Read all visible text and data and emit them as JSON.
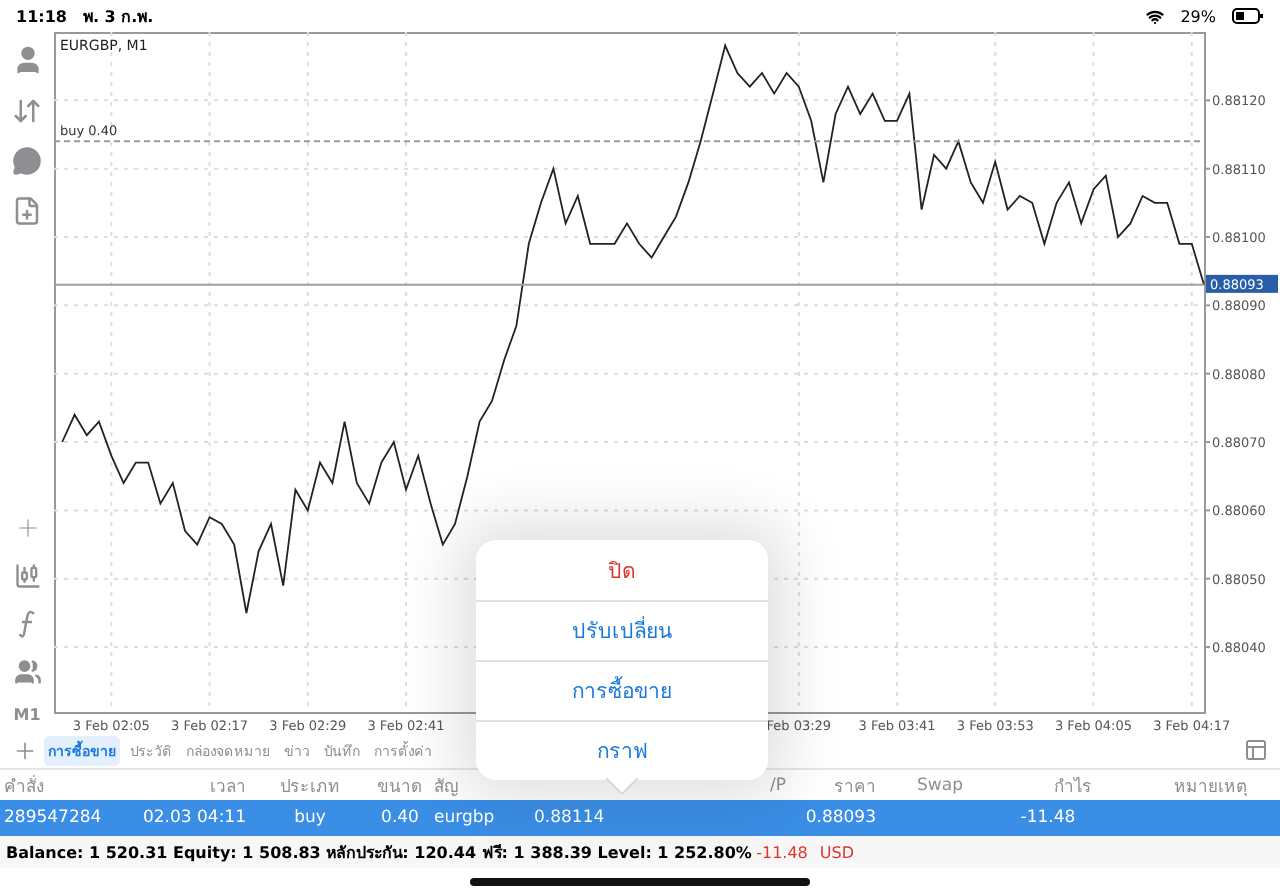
{
  "status_bar": {
    "time": "11:18",
    "date": "พ. 3 ก.พ.",
    "battery": "29%"
  },
  "toolbar": {
    "timeframe": "M1"
  },
  "chart": {
    "chart_data": {
      "type": "line",
      "title": "EURGBP, M1",
      "ylim": [
        0.880305,
        0.8813
      ],
      "categories": [
        null,
        null,
        null,
        null,
        "3 Feb 02:05",
        null,
        null,
        null,
        null,
        null,
        null,
        null,
        "3 Feb 02:17",
        null,
        null,
        null,
        null,
        null,
        null,
        null,
        "3 Feb 02:29",
        null,
        null,
        null,
        null,
        null,
        null,
        null,
        "3 Feb 02:41",
        null,
        null,
        null,
        null,
        null,
        null,
        null,
        null,
        null,
        null,
        null,
        null,
        null,
        null,
        null,
        null,
        null,
        null,
        null,
        null,
        null,
        null,
        null,
        null,
        null,
        null,
        null,
        null,
        null,
        null,
        null,
        "Feb 03:29",
        null,
        null,
        null,
        null,
        null,
        null,
        null,
        "3 Feb 03:41",
        null,
        null,
        null,
        null,
        null,
        null,
        null,
        "3 Feb 03:53",
        null,
        null,
        null,
        null,
        null,
        null,
        null,
        "3 Feb 04:05",
        null,
        null,
        null,
        null,
        null,
        null,
        null,
        "3 Feb 04:17",
        null
      ],
      "grid": true,
      "series": [
        {
          "color": "#222222",
          "values": [
            0.8807,
            0.88074,
            0.88071,
            0.88073,
            0.88068,
            0.88064,
            0.88067,
            0.88067,
            0.88061,
            0.88064,
            0.88057,
            0.88055,
            0.88059,
            0.88058,
            0.88055,
            0.88045,
            0.88054,
            0.88058,
            0.88049,
            0.88063,
            0.8806,
            0.88067,
            0.88064,
            0.88073,
            0.88064,
            0.88061,
            0.88067,
            0.8807,
            0.88063,
            0.88068,
            0.88061,
            0.88055,
            0.88058,
            0.88065,
            0.88073,
            0.88076,
            0.88082,
            0.88087,
            0.88099,
            0.88105,
            0.8811,
            0.88102,
            0.88106,
            0.88099,
            0.88099,
            0.88099,
            0.88102,
            0.88099,
            0.88097,
            0.881,
            0.88103,
            0.88108,
            0.88114,
            0.88121,
            0.88128,
            0.88124,
            0.88122,
            0.88124,
            0.88121,
            0.88124,
            0.88122,
            0.88117,
            0.88108,
            0.88118,
            0.88122,
            0.88118,
            0.88121,
            0.88117,
            0.88117,
            0.88121,
            0.88104,
            0.88112,
            0.8811,
            0.88114,
            0.88108,
            0.88105,
            0.88111,
            0.88104,
            0.88106,
            0.88105,
            0.88099,
            0.88105,
            0.88108,
            0.88102,
            0.88107,
            0.88109,
            0.881,
            0.88102,
            0.88106,
            0.88105,
            0.88105,
            0.88099,
            0.88099,
            0.88093
          ]
        }
      ],
      "yticks": [
        {
          "value": 0.8804,
          "label": "0.88040"
        },
        {
          "value": 0.8805,
          "label": "0.88050"
        },
        {
          "value": 0.8806,
          "label": "0.88060"
        },
        {
          "value": 0.8807,
          "label": "0.88070"
        },
        {
          "value": 0.8808,
          "label": "0.88080"
        },
        {
          "value": 0.8809,
          "label": "0.88090"
        },
        {
          "value": 0.881,
          "label": "0.88100"
        },
        {
          "value": 0.8811,
          "label": "0.88110"
        },
        {
          "value": 0.8812,
          "label": "0.88120"
        }
      ],
      "ref_lines": [
        {
          "axis": "y",
          "value": 0.88114,
          "label": "buy 0.40"
        },
        {
          "axis": "y",
          "value": 0.88093,
          "label": "0.88093"
        }
      ]
    }
  },
  "tabs": [
    {
      "label": "การซื้อขาย",
      "selected": true
    },
    {
      "label": "ประวัติ",
      "selected": false
    },
    {
      "label": "กล่องจดหมาย",
      "selected": false
    },
    {
      "label": "ข่าว",
      "selected": false
    },
    {
      "label": "บันทึก",
      "selected": false
    },
    {
      "label": "การตั้งค่า",
      "selected": false
    }
  ],
  "table": {
    "columns": [
      "คำสั่ง",
      "เวลา",
      "ประเภท",
      "ขนาด",
      "สัญ",
      "/P",
      "ราคา",
      "Swap",
      "กำไร",
      "หมายเหตุ"
    ],
    "rows": [
      {
        "selected": true,
        "cells": [
          "289547284",
          "02.03 04:11",
          "buy",
          "0.40",
          "eurgbp",
          "0.88114",
          "0.88093",
          "-11.48"
        ]
      }
    ]
  },
  "summary": {
    "text": "Balance: 1 520.31 Equity: 1 508.83 หลักประกัน: 120.44 ฟรี: 1 388.39 Level: 1 252.80%",
    "profit": "-11.48",
    "currency": "USD"
  },
  "popover": {
    "items": [
      {
        "label": "ปิด",
        "kind": "destructive"
      },
      {
        "label": "ปรับเปลี่ยน",
        "kind": "action"
      },
      {
        "label": "การซื้อขาย",
        "kind": "action"
      },
      {
        "label": "กราฟ",
        "kind": "action"
      }
    ]
  }
}
